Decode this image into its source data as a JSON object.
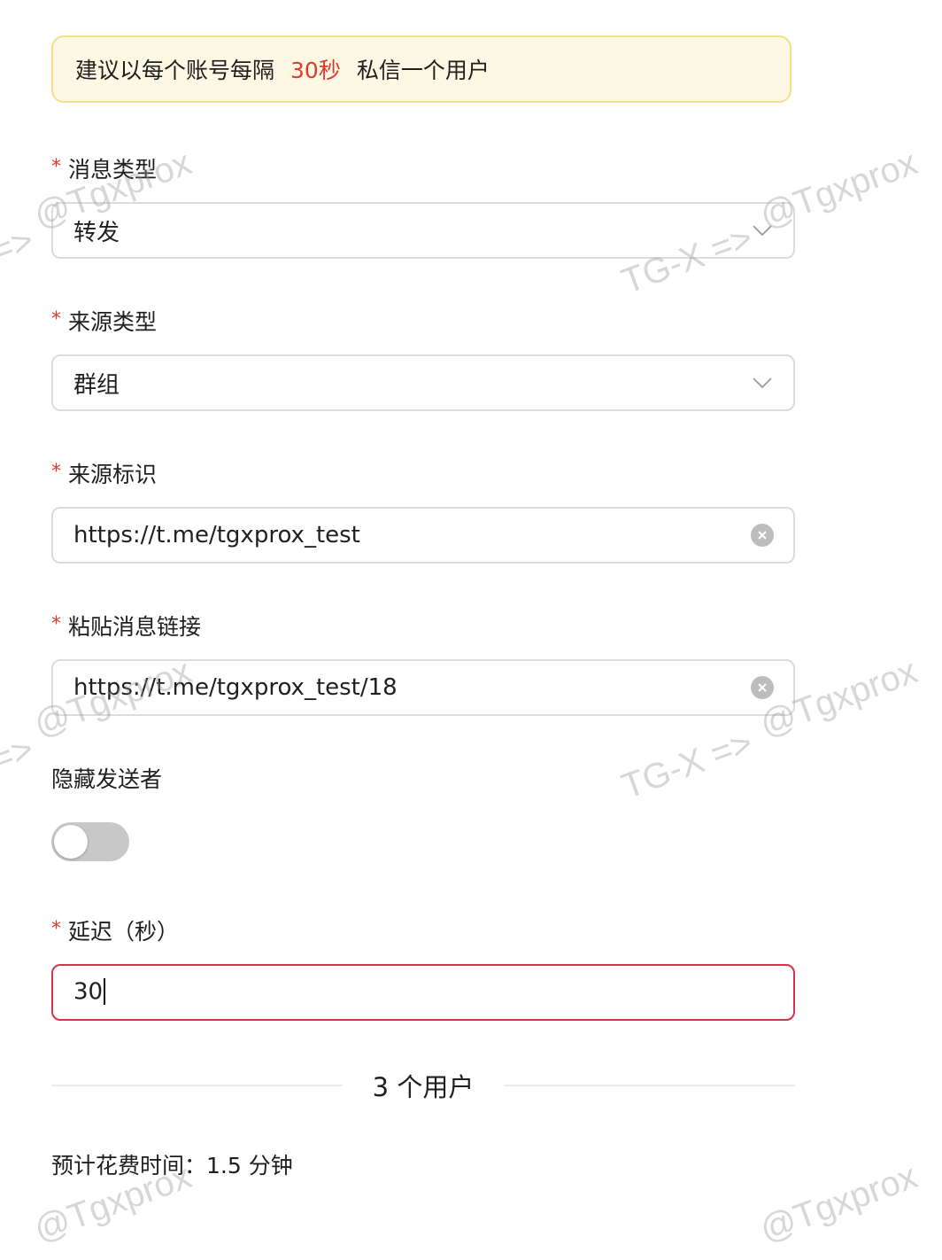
{
  "notice": {
    "before": "建议以每个账号每隔",
    "highlight": "30秒",
    "after": "私信一个用户",
    "highlight_color": "#e2382e",
    "background_color": "#fdf8e3",
    "border_color": "#f3df8a"
  },
  "form": {
    "required_mark": "*",
    "message_type": {
      "label": "消息类型",
      "value": "转发",
      "icon": "chevron-down-icon"
    },
    "source_type": {
      "label": "来源类型",
      "value": "群组",
      "icon": "chevron-down-icon"
    },
    "source_id": {
      "label": "来源标识",
      "value": "https://t.me/tgxprox_test",
      "icon": "clear-icon"
    },
    "message_link": {
      "label": "粘贴消息链接",
      "value": "https://t.me/tgxprox_test/18",
      "icon": "clear-icon"
    },
    "hide_sender": {
      "label": "隐藏发送者",
      "enabled": false
    },
    "delay": {
      "label": "延迟（秒）",
      "value": "30",
      "error_color": "#d6334a"
    }
  },
  "summary": {
    "users_count": "3 个用户",
    "estimate": "预计花费时间：1.5 分钟"
  },
  "watermarks": {
    "handle": "@Tgxprox",
    "arrow": "=>",
    "brand": "TG-X =>"
  }
}
